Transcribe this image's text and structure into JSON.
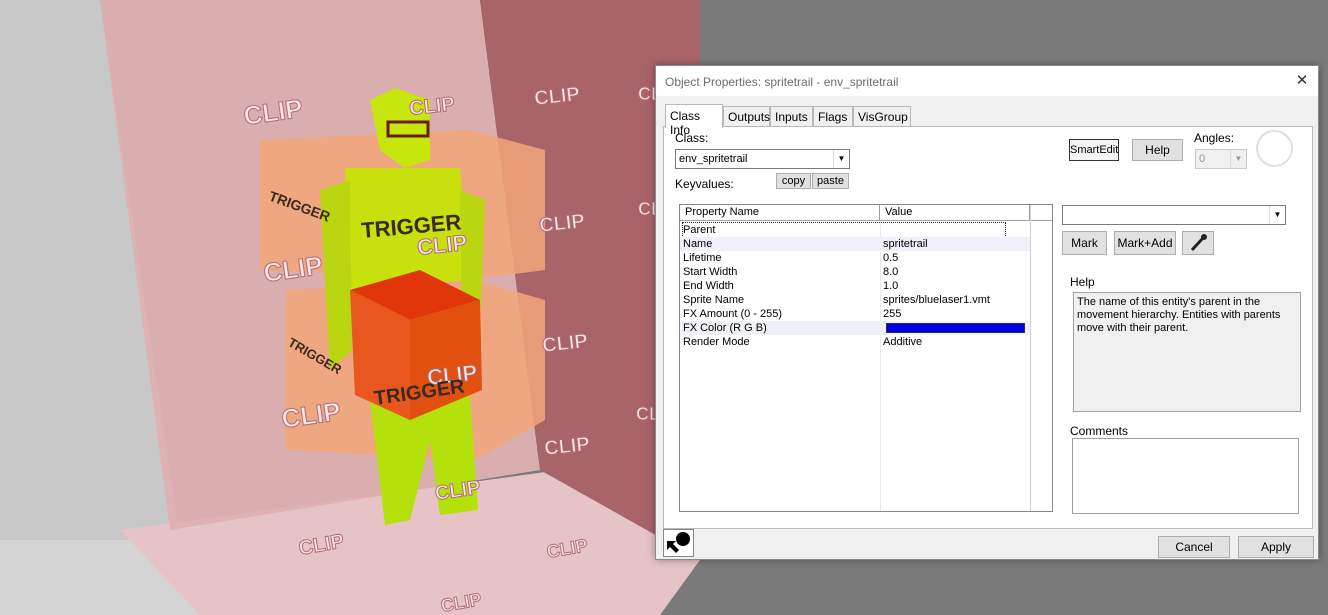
{
  "viewport": {
    "clip_label": "CLIP",
    "trigger_label": "TRIGGER",
    "colors": {
      "clip_wall": "#d9a3a5",
      "clip_wall_dark": "#a45c61",
      "trigger": "#f0a070",
      "crate": "#e8581e",
      "figure": "#c6e50a"
    }
  },
  "dialog": {
    "title": "Object Properties: spritetrail - env_spritetrail",
    "close_icon": "close-icon",
    "tabs": [
      {
        "label": "Class Info",
        "active": true
      },
      {
        "label": "Outputs",
        "active": false
      },
      {
        "label": "Inputs",
        "active": false
      },
      {
        "label": "Flags",
        "active": false
      },
      {
        "label": "VisGroup",
        "active": false
      }
    ],
    "class_label": "Class:",
    "class_value": "env_spritetrail",
    "keyvalues_label": "Keyvalues:",
    "copy_label": "copy",
    "paste_label": "paste",
    "smartedit_label": "SmartEdit",
    "help_button_label": "Help",
    "angles_label": "Angles:",
    "angles_value": "0",
    "grid": {
      "columns": [
        "Property Name",
        "Value"
      ],
      "rows": [
        {
          "key": "Parent",
          "value": ""
        },
        {
          "key": "Name",
          "value": "spritetrail"
        },
        {
          "key": "Lifetime",
          "value": "0.5"
        },
        {
          "key": "Start Width",
          "value": "8.0"
        },
        {
          "key": "End Width",
          "value": "1.0"
        },
        {
          "key": "Sprite Name",
          "value": "sprites/bluelaser1.vmt"
        },
        {
          "key": "FX Amount (0 - 255)",
          "value": "255"
        },
        {
          "key": "FX Color (R G B)",
          "value": "",
          "color": "#0000e6"
        },
        {
          "key": "Render Mode",
          "value": "Additive"
        }
      ]
    },
    "value_select": "",
    "mark_label": "Mark",
    "mark_add_label": "Mark+Add",
    "eyedropper_icon": "eyedropper-icon",
    "help_group_label": "Help",
    "help_text": "The name of this entity's parent in the movement hierarchy. Entities with parents move with their parent.",
    "comments_label": "Comments",
    "comments_value": "",
    "pointer_icon": "entity-pointer-icon",
    "cancel_label": "Cancel",
    "apply_label": "Apply"
  }
}
